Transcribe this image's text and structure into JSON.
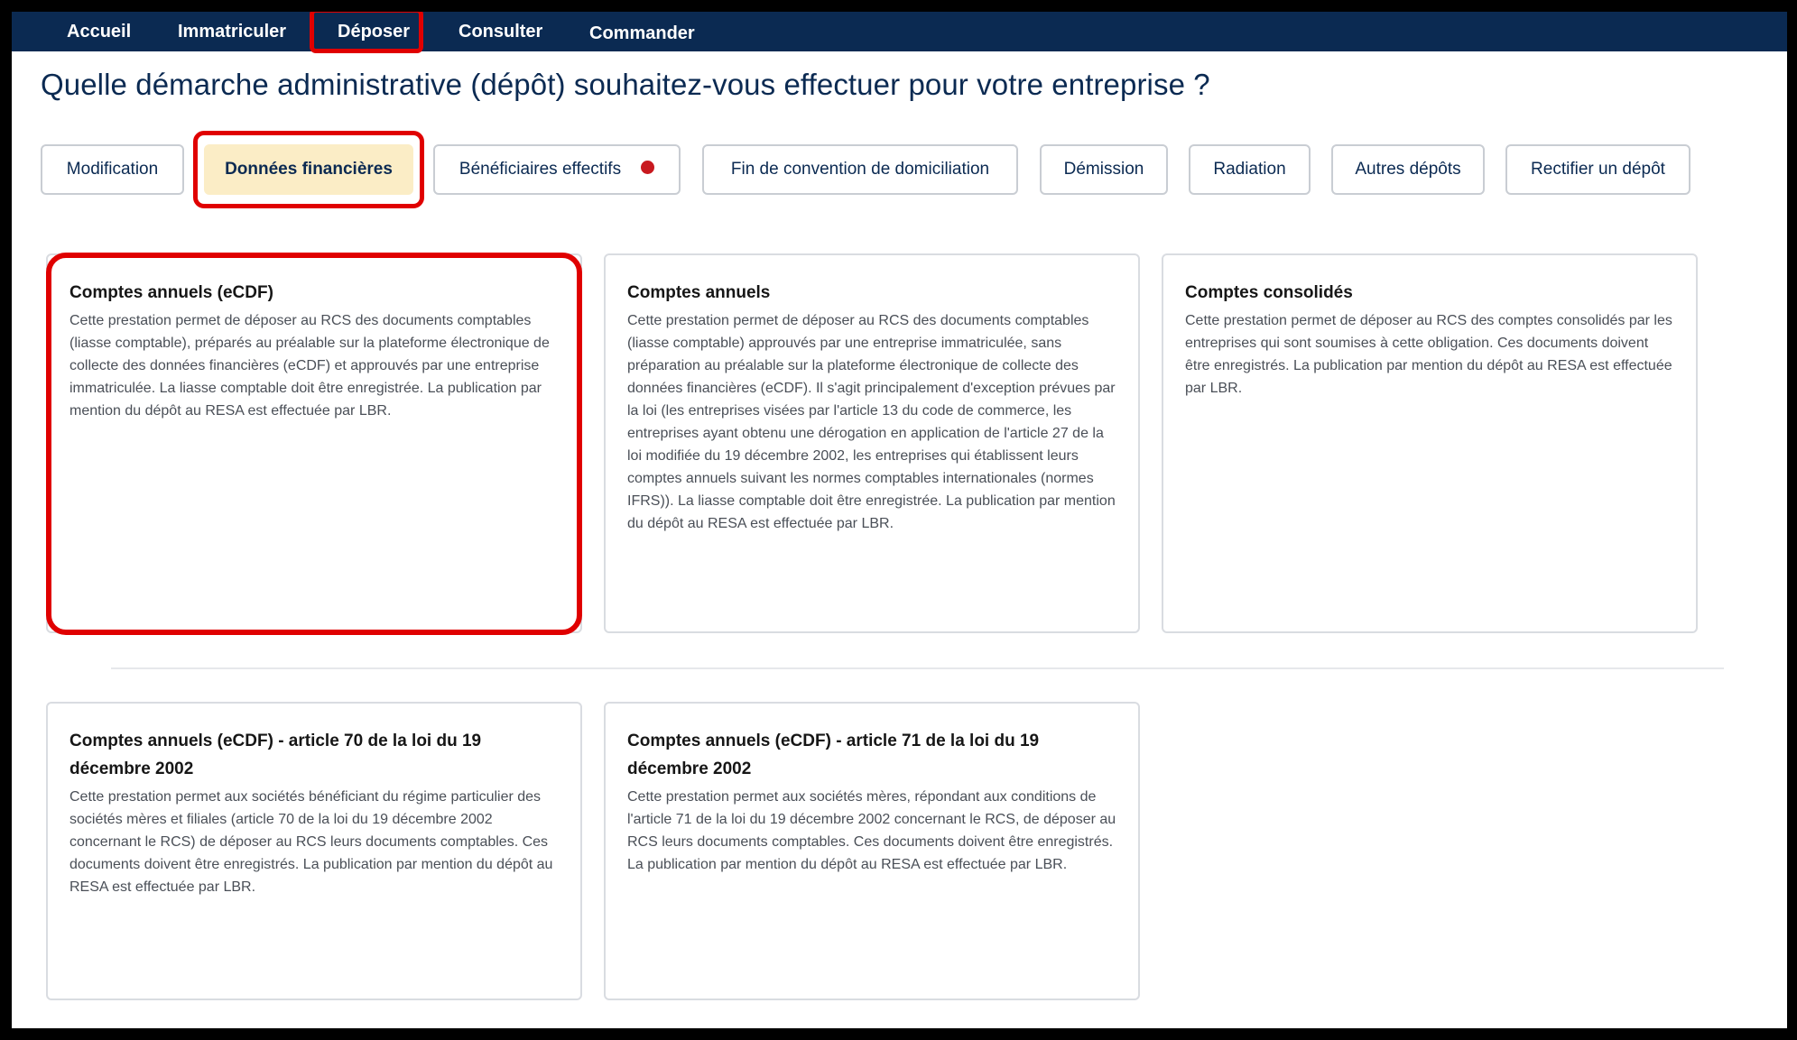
{
  "nav": {
    "items": [
      "Accueil",
      "Immatriculer",
      "Déposer",
      "Consulter",
      "Commander"
    ],
    "active": "Déposer"
  },
  "page_title": "Quelle démarche administrative (dépôt) souhaitez-vous effectuer pour votre entreprise ?",
  "tabs": [
    "Modification",
    "Données financières",
    "Bénéficiaires effectifs",
    "Fin de convention de domiciliation",
    "Démission",
    "Radiation",
    "Autres dépôts",
    "Rectifier un dépôt"
  ],
  "active_tab": "Données financières",
  "cards": [
    {
      "title": "Comptes annuels (eCDF)",
      "description": "Cette prestation permet de déposer au RCS des documents comptables (liasse comptable), préparés au préalable sur la plateforme électronique de collecte des données financières (eCDF) et approuvés par une entreprise immatriculée. La liasse comptable doit être enregistrée. La publication par mention du dépôt au RESA est effectuée par LBR."
    },
    {
      "title": "Comptes annuels",
      "description": "Cette prestation permet de déposer au RCS des documents comptables (liasse comptable) approuvés par une entreprise immatriculée, sans préparation au préalable sur la plateforme électronique de collecte des données financières (eCDF). Il s'agit principalement d'exception prévues par la loi (les entreprises visées par l'article 13 du code de commerce, les entreprises ayant obtenu une dérogation en application de l'article 27 de la loi modifiée du 19 décembre 2002, les entreprises qui établissent leurs comptes annuels suivant les normes comptables internationales (normes IFRS)). La liasse comptable doit être enregistrée. La publication par mention du dépôt au RESA est effectuée par LBR."
    },
    {
      "title": "Comptes consolidés",
      "description": "Cette prestation permet de déposer au RCS des comptes consolidés par les entreprises qui sont soumises à cette obligation. Ces documents doivent être enregistrés. La publication par mention du dépôt au RESA est effectuée par LBR."
    },
    {
      "title": "Comptes annuels (eCDF) - article 70 de la loi du 19 décembre 2002",
      "description": "Cette prestation permet aux sociétés bénéficiant du régime particulier des sociétés mères et filiales (article 70 de la loi du 19 décembre 2002 concernant le RCS) de déposer au RCS leurs documents comptables. Ces documents doivent être enregistrés. La publication par mention du dépôt au RESA est effectuée par LBR."
    },
    {
      "title": "Comptes annuels (eCDF) - article 71 de la loi du 19 décembre 2002",
      "description": "Cette prestation permet aux sociétés mères, répondant aux conditions de l'article 71 de la loi du 19 décembre 2002 concernant le RCS, de déposer au RCS leurs documents comptables. Ces documents doivent être enregistrés. La publication par mention du dépôt au RESA est effectuée par LBR."
    }
  ],
  "colors": {
    "nav_bg": "#0b2a52",
    "active_tab_bg": "#fbedc6",
    "highlight": "#e00000",
    "status_dot": "#c8191f"
  }
}
